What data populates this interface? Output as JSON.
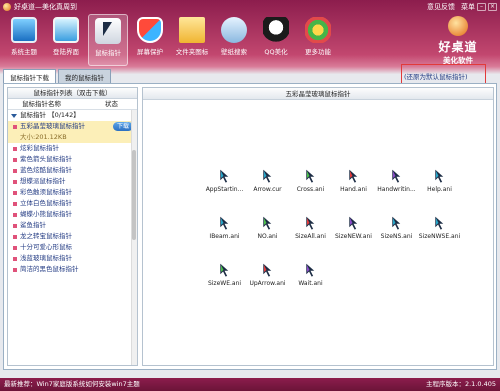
{
  "window": {
    "title": "好桌道—美化真周到",
    "feedback": "意见反馈",
    "menu": "菜单",
    "minimize": "–",
    "close": "×"
  },
  "toolbar": [
    {
      "label": "系统主题",
      "icon": "monitor-icon"
    },
    {
      "label": "登陆界面",
      "icon": "desktop-icon"
    },
    {
      "label": "鼠标指针",
      "icon": "cursor-icon",
      "active": true
    },
    {
      "label": "屏幕保护",
      "icon": "shield-icon"
    },
    {
      "label": "文件夹图标",
      "icon": "folder-icon"
    },
    {
      "label": "壁纸搜索",
      "icon": "wallpaper-search-icon"
    },
    {
      "label": "QQ美化",
      "icon": "qq-icon"
    },
    {
      "label": "更多功能",
      "icon": "more-icon"
    }
  ],
  "brand": {
    "line1": "好桌道",
    "line2": "美化软件"
  },
  "tabs": [
    "鼠标指针下载",
    "我的鼠标指针"
  ],
  "restore_link": "(还原为默认鼠标指针)",
  "sidebar": {
    "header": "鼠标指针列表（双击下载）",
    "col_name": "鼠标指针名称",
    "col_status": "状态",
    "group": "鼠标指针 【0/142】",
    "selected": {
      "name": "五彩晶莹玻璃鼠标指针",
      "size": "大小:201.12KB",
      "button": "下载"
    },
    "items": [
      "炫彩鼠标指针",
      "紫色箭头鼠标指针",
      "蓝色炫酷鼠标指针",
      "想蝶派鼠标指针",
      "彩色触须鼠标指针",
      "立体白色鼠标指针",
      "蝴蝶小熊鼠标指针",
      "鲨鱼指针",
      "龙之转宝鼠标指针",
      "十分可爱心形鼠标",
      "浅蓝玻璃鼠标指针",
      "简洁的黑色鼠标指针"
    ]
  },
  "preview": {
    "title": "五彩晶莹玻璃鼠标指针",
    "cursors": [
      {
        "name": "AppStartin...",
        "color": "#27a6c9"
      },
      {
        "name": "Arrow.cur",
        "color": "#27a6c9"
      },
      {
        "name": "Cross.ani",
        "color": "#4bbf4b"
      },
      {
        "name": "Hand.ani",
        "color": "#e23a3a"
      },
      {
        "name": "Handwritin...",
        "color": "#8a4bc9"
      },
      {
        "name": "Help.ani",
        "color": "#27a6c9"
      },
      {
        "name": "IBeam.ani",
        "color": "#27a6c9"
      },
      {
        "name": "NO.ani",
        "color": "#4bbf4b"
      },
      {
        "name": "SizeAll.ani",
        "color": "#e23a3a"
      },
      {
        "name": "SizeNEW.ani",
        "color": "#8a4bc9"
      },
      {
        "name": "SizeNS.ani",
        "color": "#27a6c9"
      },
      {
        "name": "SizeNWSE.ani",
        "color": "#27a6c9"
      },
      {
        "name": "SizeWE.ani",
        "color": "#4bbf4b"
      },
      {
        "name": "UpArrow.ani",
        "color": "#e23a3a"
      },
      {
        "name": "Wait.ani",
        "color": "#8a4bc9"
      }
    ]
  },
  "status": {
    "left": "最新推荐：Win7家庭版系统如何安装win7主题",
    "right": "主程序版本：2.1.0.405"
  }
}
